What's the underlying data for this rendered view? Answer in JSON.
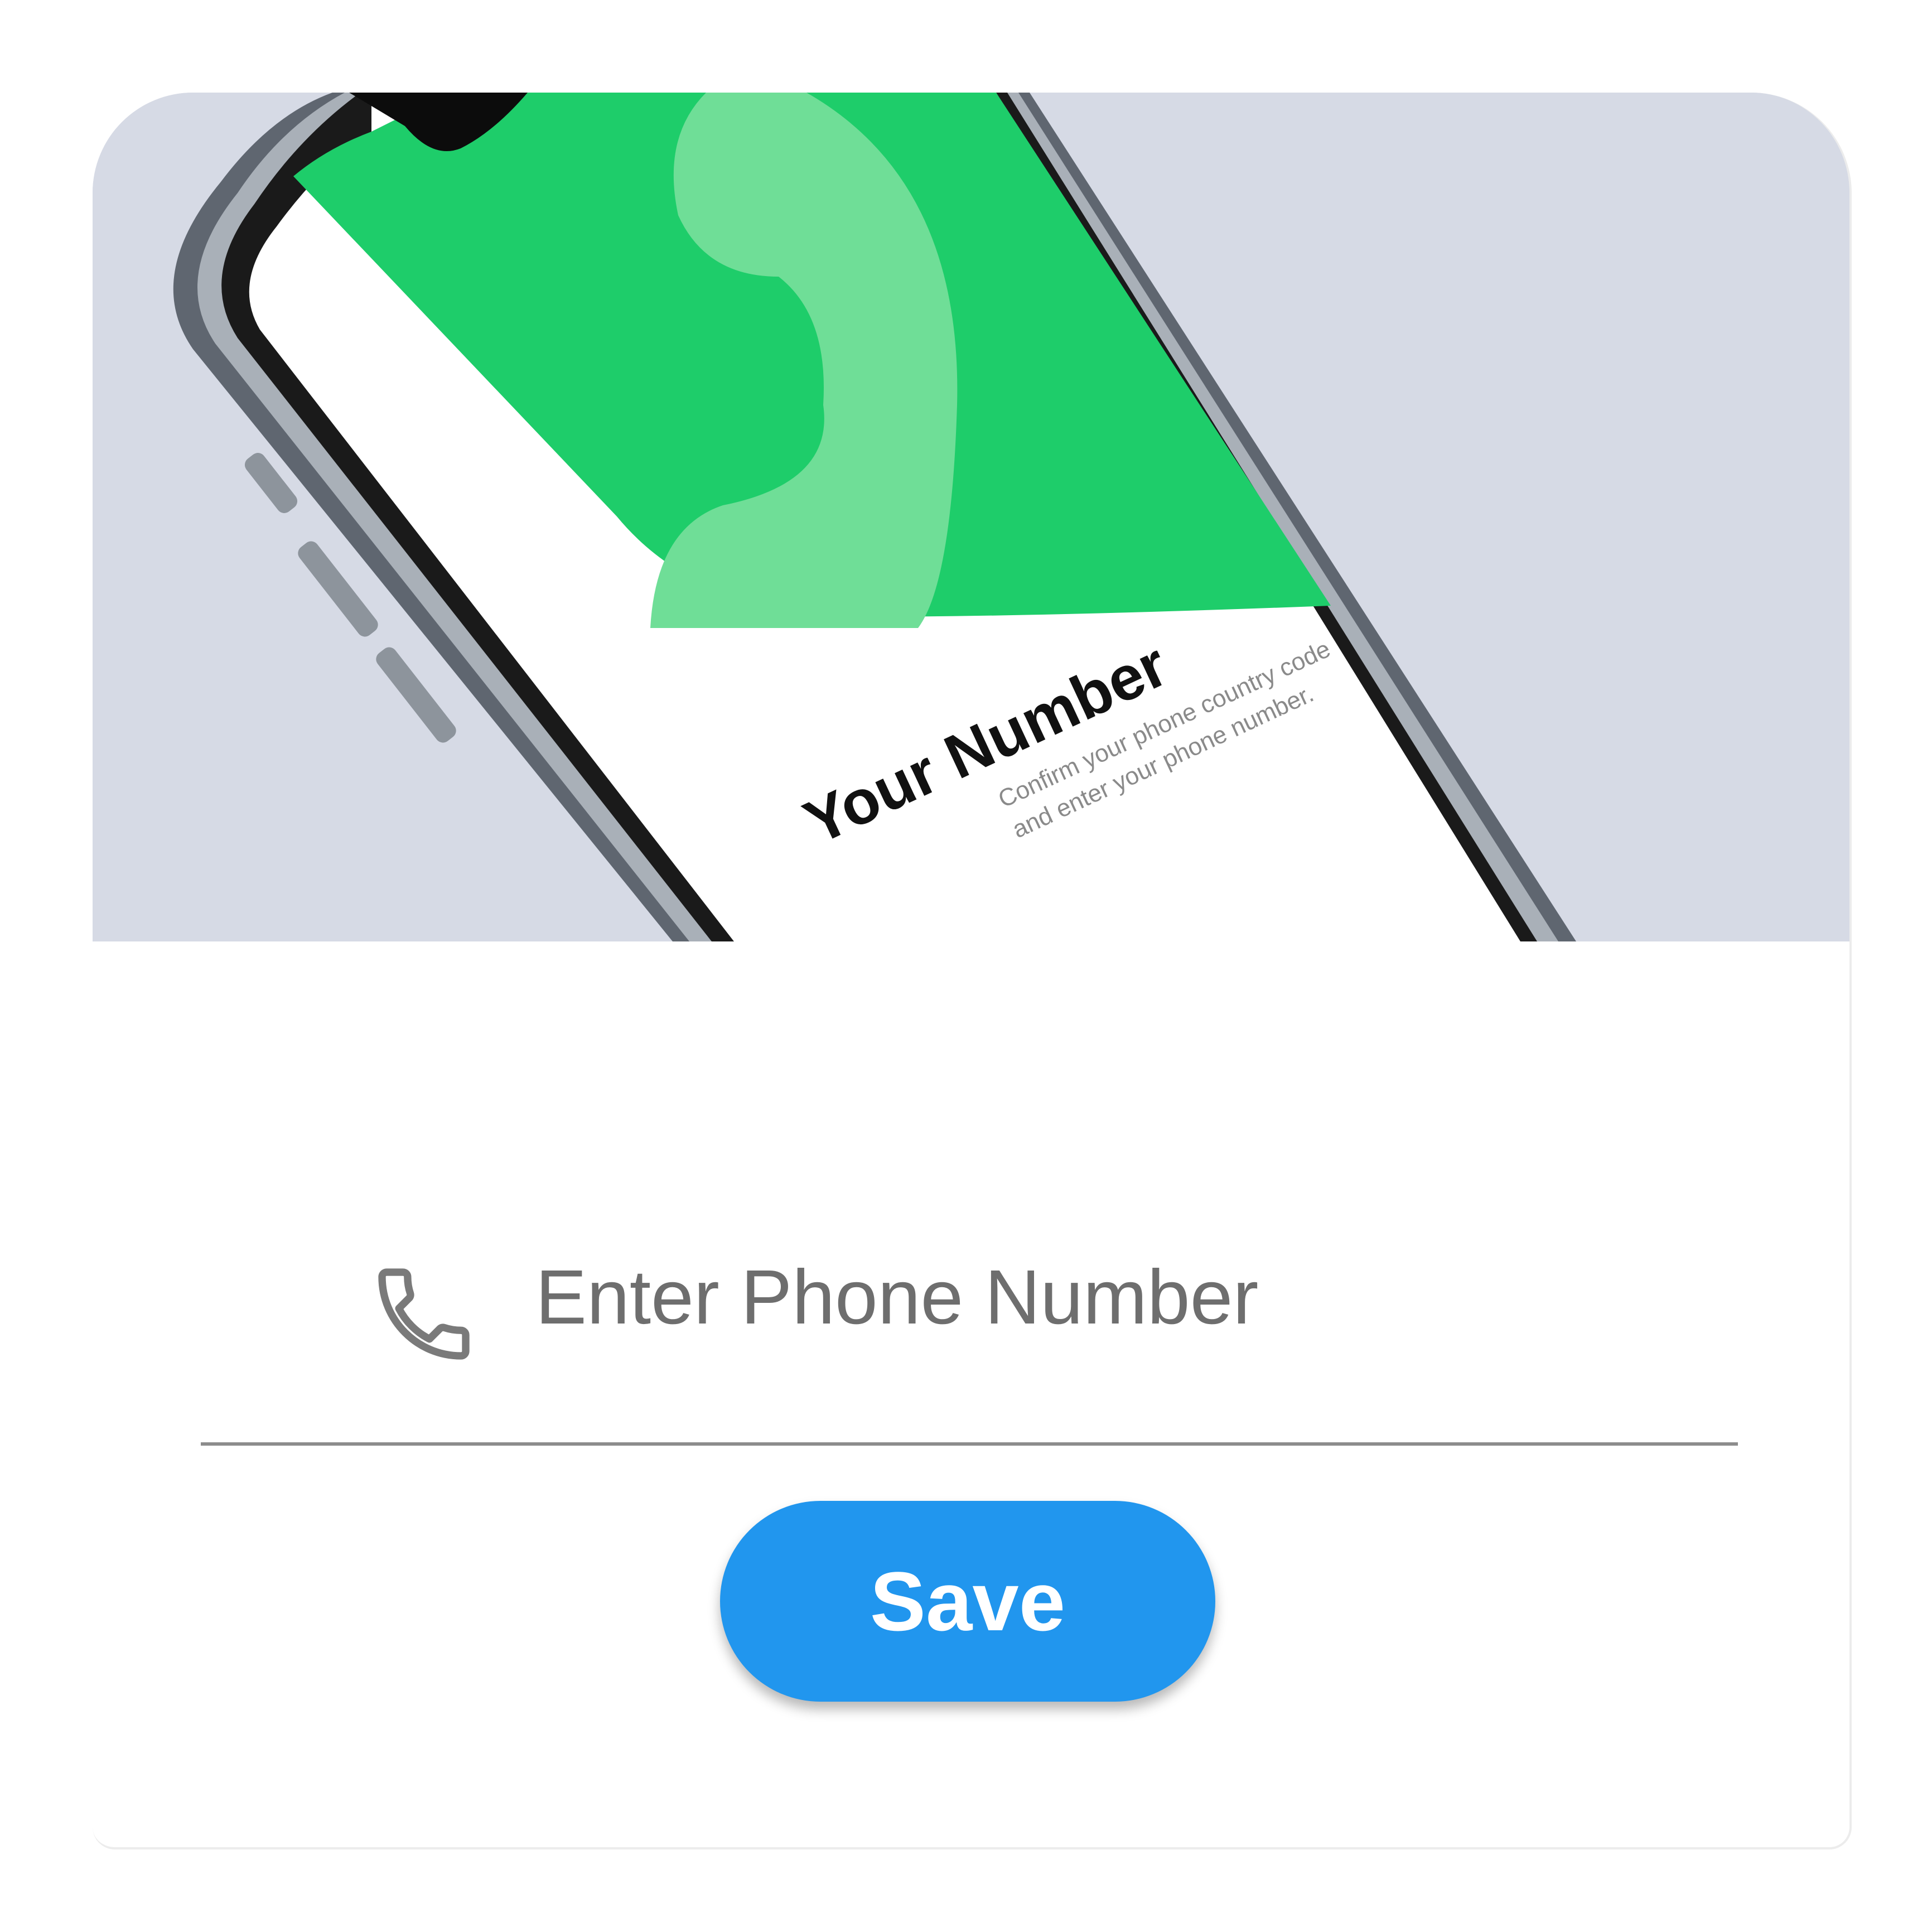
{
  "hero": {
    "screen_title": "Your Number",
    "screen_subtitle_line1": "Confirm your phone country code",
    "screen_subtitle_line2": "and enter your phone number.",
    "colors": {
      "background": "#d6dae5",
      "screen_green": "#1ecd6a",
      "handset_tint": "#6fde97",
      "frame": "#2b2b2b"
    },
    "handset_icon": "phone-handset-icon"
  },
  "form": {
    "phone_icon": "phone-icon",
    "phone_placeholder": "Enter Phone Number",
    "phone_value": "",
    "save_label": "Save",
    "colors": {
      "accent": "#2196ee",
      "placeholder": "#6e6e6e",
      "underline": "#8c8c8c"
    }
  }
}
